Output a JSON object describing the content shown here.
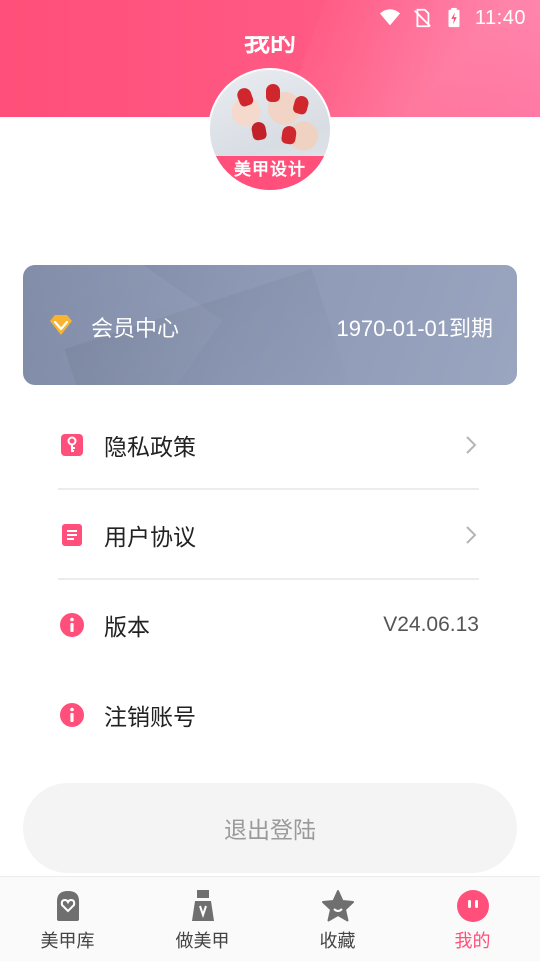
{
  "status_bar": {
    "time": "11:40"
  },
  "header": {
    "title": "我的"
  },
  "avatar": {
    "banner_text": "美甲设计"
  },
  "member": {
    "label": "会员中心",
    "expiry": "1970-01-01到期"
  },
  "menu": {
    "privacy": "隐私政策",
    "agreement": "用户协议",
    "version_label": "版本",
    "version_value": "V24.06.13",
    "deactivate": "注销账号"
  },
  "logout": {
    "label": "退出登陆"
  },
  "nav": {
    "items": [
      {
        "label": "美甲库",
        "icon": "nail-library-icon"
      },
      {
        "label": "做美甲",
        "icon": "nail-polish-icon"
      },
      {
        "label": "收藏",
        "icon": "star-icon"
      },
      {
        "label": "我的",
        "icon": "profile-icon",
        "active": true
      }
    ]
  },
  "colors": {
    "accent": "#ff4f7a",
    "member_card": "#8d99b5",
    "vip_gold": "#f7b331"
  }
}
